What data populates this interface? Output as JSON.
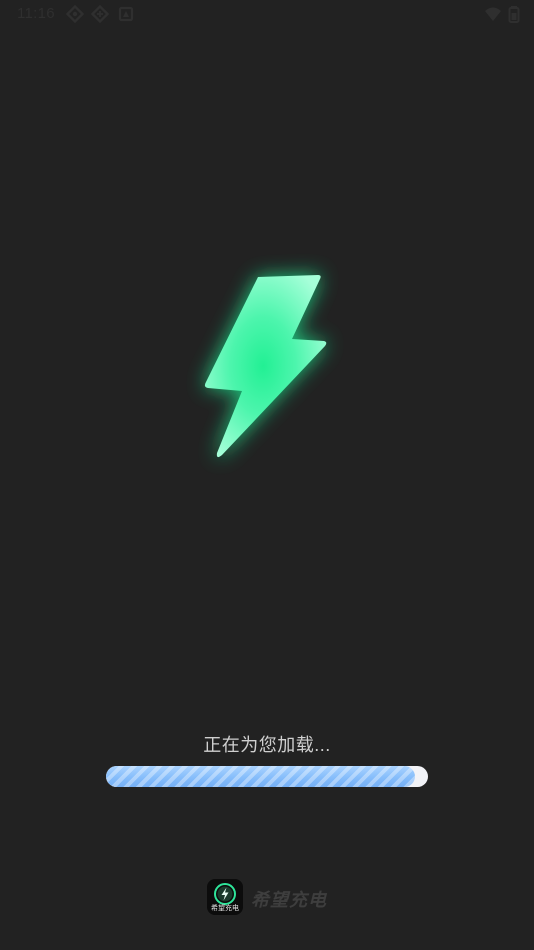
{
  "status_bar": {
    "time": "11:16",
    "left_icons": [
      "sync-icon",
      "crosshair-icon",
      "sync-icon",
      "notification-icon"
    ],
    "right_icons": [
      "wifi-icon",
      "battery-icon"
    ]
  },
  "hero": {
    "icon": "lightning-bolt-icon",
    "colors": {
      "glow": "#2ef3a0",
      "highlight": "#8fffd0",
      "core": "#1fe58f"
    }
  },
  "loading": {
    "message": "正在为您加载...",
    "progress_percent": 96,
    "colors": {
      "track": "#f2f3f7",
      "fill": "#86bdfb"
    }
  },
  "brand": {
    "app_icon_label": "希望充电",
    "app_name": "希望充电"
  },
  "theme": {
    "background": "#222222"
  }
}
